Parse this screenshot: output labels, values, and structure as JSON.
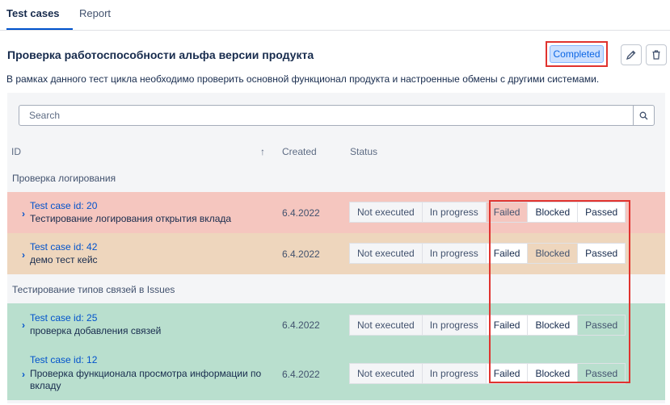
{
  "tabs": [
    {
      "label": "Test cases"
    },
    {
      "label": "Report"
    }
  ],
  "cycle": {
    "title": "Проверка работоспособности альфа версии продукта",
    "status": "Completed",
    "description": "В рамках данного тест цикла необходимо проверить основной функционал продукта и настроенные обмены с другими системами."
  },
  "icons": {
    "edit": "pencil-icon",
    "delete": "trash-icon",
    "search": "search-icon",
    "sort": "arrow-up-icon",
    "expand": "chevron-right-icon"
  },
  "search": {
    "placeholder": "Search",
    "value": ""
  },
  "table": {
    "headers": {
      "id": "ID",
      "sort_arrow": "↑",
      "created": "Created",
      "status": "Status"
    },
    "status_options": [
      "Not executed",
      "In progress",
      "Failed",
      "Blocked",
      "Passed"
    ],
    "groups": [
      {
        "name": "Проверка логирования",
        "cases": [
          {
            "id_label": "Test case id: 20",
            "name": "Тестирование логирования открытия вклада",
            "created": "6.4.2022",
            "status": "Failed"
          },
          {
            "id_label": "Test case id: 42",
            "name": "демо тест кейс",
            "created": "6.4.2022",
            "status": "Blocked"
          }
        ]
      },
      {
        "name": "Тестирование типов связей в Issues",
        "cases": [
          {
            "id_label": "Test case id: 25",
            "name": "проверка добавления связей",
            "created": "6.4.2022",
            "status": "Passed"
          },
          {
            "id_label": "Test case id: 12",
            "name": "Проверка функционала просмотра информации по вкладу",
            "created": "6.4.2022",
            "status": "Passed"
          }
        ]
      }
    ]
  },
  "colors": {
    "failed": "#f5c6bf",
    "blocked": "#eed6bd",
    "passed": "#b9dfce",
    "accent": "#0052cc",
    "highlight": "#e0332f"
  }
}
